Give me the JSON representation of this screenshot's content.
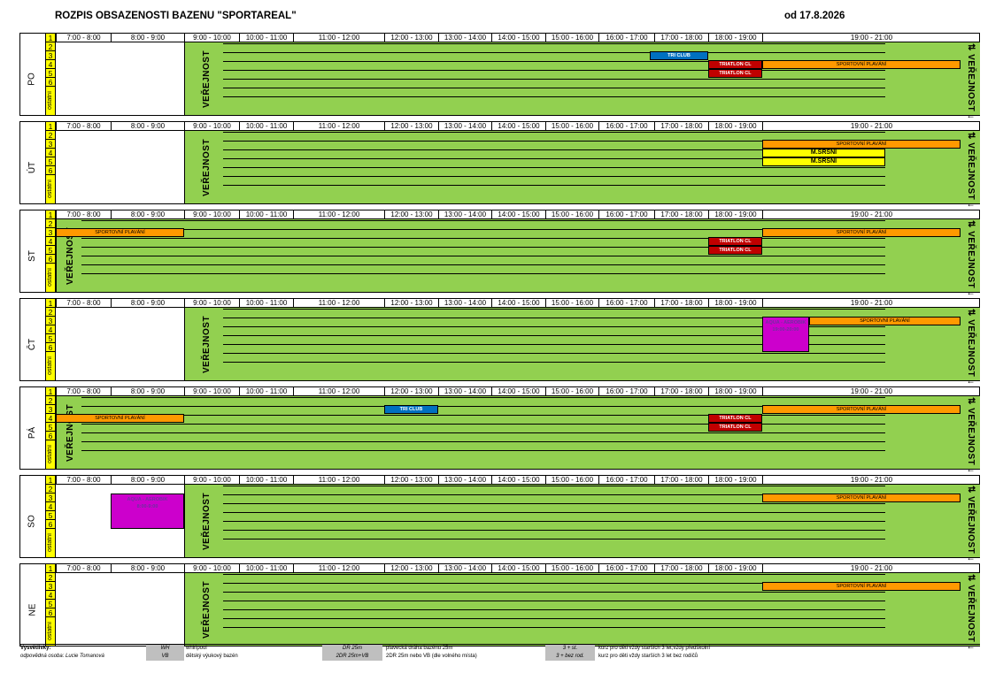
{
  "title": "ROZPIS OBSAZENOSTI BAZENU \"SPORTAREAL\"",
  "valid_from": "od 17.8.2026",
  "time_slots": [
    "7:00 - 8:00",
    "8:00 - 9:00",
    "9:00 - 10:00",
    "10:00 - 11:00",
    "11:00 - 12:00",
    "12:00 - 13:00",
    "13:00 - 14:00",
    "14:00 - 15:00",
    "15:00 - 16:00",
    "16:00 - 17:00",
    "17:00 - 18:00",
    "18:00 - 19:00",
    "19:00 - 21:00"
  ],
  "lanes": [
    "1",
    "2",
    "3",
    "4",
    "5",
    "6",
    "ostatní"
  ],
  "verejnost_label": "VEŘEJNOST",
  "days": [
    {
      "name": "PO",
      "blocks": [
        {
          "text": "TRI CLUB",
          "style": "blue"
        },
        {
          "text": "TRIATLON CL",
          "style": "red"
        },
        {
          "text": "TRIATLON CL",
          "style": "red"
        },
        {
          "text": "SPORTOVNÍ PLAVÁNÍ",
          "style": "orange"
        }
      ]
    },
    {
      "name": "ÚT",
      "blocks": [
        {
          "text": "SPORTOVNÍ PLAVÁNÍ",
          "style": "orange"
        },
        {
          "text": "M.SRŠNI",
          "style": "yellow"
        },
        {
          "text": "M.SRŠNI",
          "style": "yellow"
        }
      ]
    },
    {
      "name": "ST",
      "blocks": [
        {
          "text": "SPORTOVNÍ PLAVÁNÍ",
          "style": "orange"
        },
        {
          "text": "SPORTOVNÍ PLAVÁNÍ",
          "style": "orange"
        },
        {
          "text": "TRIATLON CL",
          "style": "red"
        },
        {
          "text": "TRIATLON CL",
          "style": "red"
        }
      ]
    },
    {
      "name": "ČT",
      "blocks": [
        {
          "text": "AQUA - AEROBIK",
          "sub": "19:00-20:00",
          "style": "magenta"
        },
        {
          "text": "SPORTOVNÍ PLAVÁNÍ",
          "style": "orange"
        }
      ]
    },
    {
      "name": "PÁ",
      "blocks": [
        {
          "text": "TRI CLUB",
          "style": "blue"
        },
        {
          "text": "SPORTOVNÍ PLAVÁNÍ",
          "style": "orange"
        },
        {
          "text": "SPORTOVNÍ PLAVÁNÍ",
          "style": "orange"
        },
        {
          "text": "TRIATLON CL",
          "style": "red"
        },
        {
          "text": "TRIATLON CL",
          "style": "red"
        }
      ]
    },
    {
      "name": "SO",
      "blocks": [
        {
          "text": "AQUA - AEROBIK",
          "sub": "8:00-9:00",
          "style": "magenta"
        },
        {
          "text": "SPORTOVNÍ PLAVÁNÍ",
          "style": "orange"
        }
      ]
    },
    {
      "name": "NE",
      "blocks": [
        {
          "text": "SPORTOVNÍ PLAVÁNÍ",
          "style": "orange"
        }
      ]
    }
  ],
  "legend": {
    "heading": "Vysvětlivky:",
    "responsible": "odpovědná osoba: Lucie Tomanová",
    "rows": [
      {
        "code": "WH",
        "desc": "whirlpool"
      },
      {
        "code": "VB",
        "desc": "dětský výukový bazén"
      },
      {
        "code": "DR 25m",
        "desc": "plavecká dráha bazénu 25m"
      },
      {
        "code": "2DR 25m+VB",
        "desc": "2DR 25m nebo VB (dle volného místa)"
      },
      {
        "code": "3 + st.",
        "desc": "kurz pro děti vždy starších 3 let,vždy předškolní"
      },
      {
        "code": "3 + bez rod.",
        "desc": "kurz pro děti vždy starších 3 let bez rodičů"
      }
    ]
  },
  "colors": {
    "green": "#92d050",
    "orange": "#ff9900",
    "red": "#c00000",
    "blue": "#0070c0",
    "yellow": "#ffff00",
    "magenta": "#cc00cc"
  }
}
